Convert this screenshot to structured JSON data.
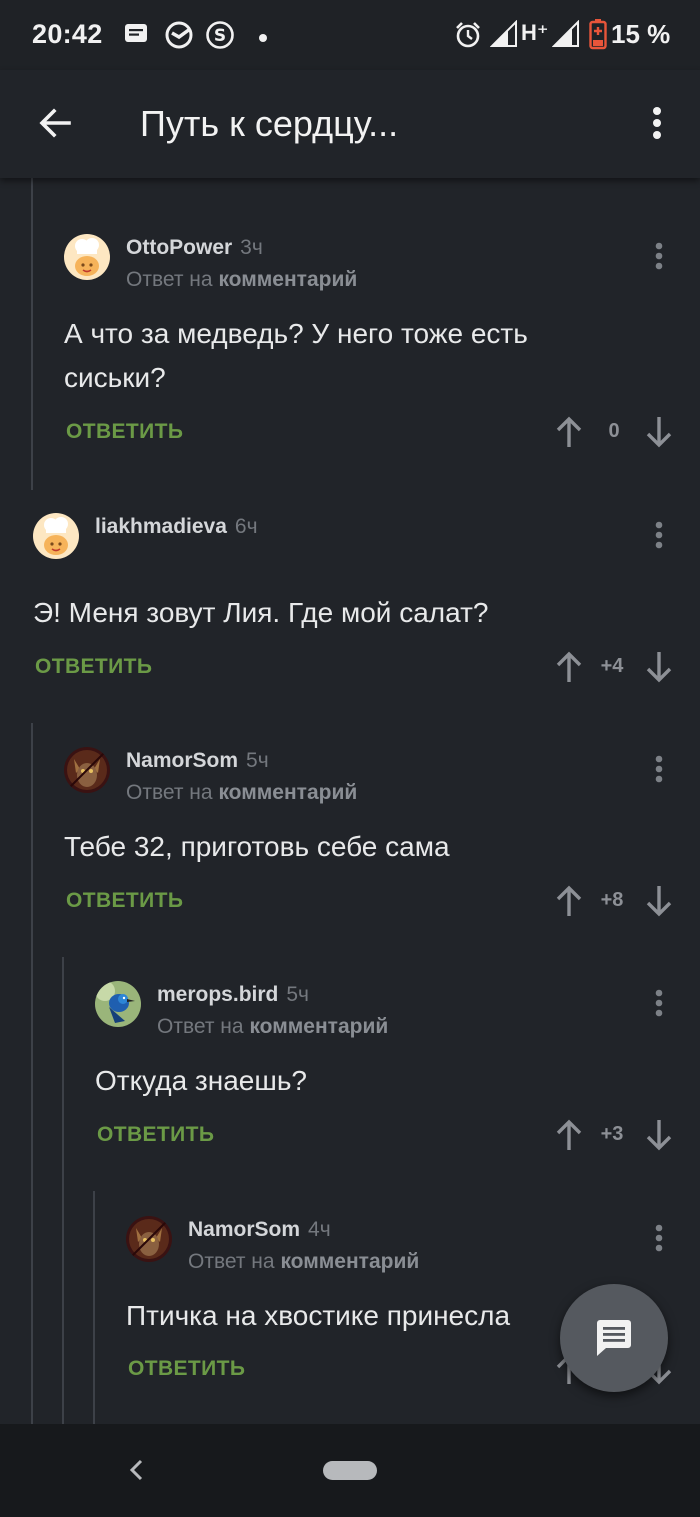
{
  "status_bar": {
    "time": "20:42",
    "network": "H⁺",
    "battery": "15 %",
    "icons": [
      "message-icon",
      "sber-icon",
      "dollar-icon",
      "dot-icon",
      "alarm-icon",
      "signal-icon",
      "signal-icon",
      "battery-icon"
    ]
  },
  "app_bar": {
    "title": "Путь к сердцу...",
    "back_icon": "arrow-left-icon",
    "menu_icon": "more-vertical-icon"
  },
  "comments": [
    {
      "user": "OttoPower",
      "time": "3ч",
      "reply_prefix": "Ответ на",
      "reply_target": "комментарий",
      "text": [
        "А что за медведь? У него тоже есть",
        "сиськи?"
      ],
      "answer": "ОТВЕТИТЬ",
      "votes": "0",
      "avatar": "chef-avatar"
    },
    {
      "user": "liakhmadieva",
      "time": "6ч",
      "text": [
        "Э! Меня зовут Лия. Где мой салат?"
      ],
      "answer": "ОТВЕТИТЬ",
      "votes": "+4",
      "avatar": "chef-avatar"
    },
    {
      "user": "NamorSom",
      "time": "5ч",
      "reply_prefix": "Ответ на",
      "reply_target": "комментарий",
      "text": [
        "Тебе 32, приготовь себе сама"
      ],
      "answer": "ОТВЕТИТЬ",
      "votes": "+8",
      "avatar": "cat-avatar"
    },
    {
      "user": "merops.bird",
      "time": "5ч",
      "reply_prefix": "Ответ на",
      "reply_target": "комментарий",
      "text": [
        "Откуда знаешь?"
      ],
      "answer": "ОТВЕТИТЬ",
      "votes": "+3",
      "avatar": "bird-avatar"
    },
    {
      "user": "NamorSom",
      "time": "4ч",
      "reply_prefix": "Ответ на",
      "reply_target": "комментарий",
      "text": [
        "Птичка на хвостике принесла"
      ],
      "answer": "ОТВЕТИТЬ",
      "votes": "",
      "avatar": "cat-avatar"
    }
  ],
  "fab": {
    "icon": "comment-icon"
  },
  "nav_bar": {
    "back_icon": "chevron-left-icon",
    "home": "home-pill"
  },
  "colors": {
    "background": "#212429",
    "answer_green": "#6b9a46",
    "muted": "#74787e"
  }
}
